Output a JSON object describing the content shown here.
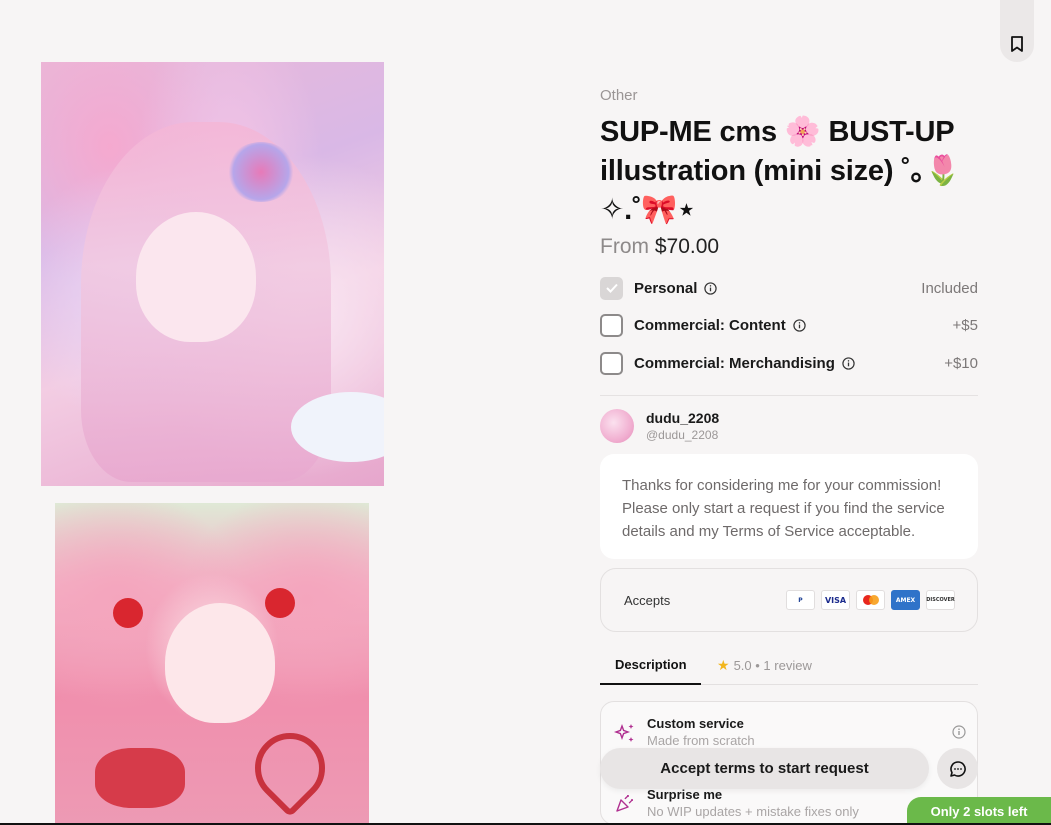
{
  "listing": {
    "category": "Other",
    "title": "SUP-ME cms 🌸 BUST-UP illustration (mini size) ˚｡🌷 ✧.˚🎀⋆",
    "price_prefix": "From",
    "price": "$70.00"
  },
  "licenses": [
    {
      "label": "Personal",
      "price": "Included",
      "checked": true
    },
    {
      "label": "Commercial: Content",
      "price": "+$5",
      "checked": false
    },
    {
      "label": "Commercial: Merchandising",
      "price": "+$10",
      "checked": false
    }
  ],
  "artist": {
    "name": "dudu_2208",
    "handle": "@dudu_2208",
    "message": "Thanks for considering me for your commission! Please only start a request if you find the service details and my Terms of Service acceptable."
  },
  "accepts": {
    "label": "Accepts",
    "methods": [
      "PayPal",
      "VISA",
      "Mastercard",
      "AMEX",
      "DISCOVER"
    ]
  },
  "tabs": {
    "description": "Description",
    "rating": "5.0",
    "reviews": "• 1 review"
  },
  "services": [
    {
      "title": "Custom service",
      "subtitle": "Made from scratch",
      "icon": "sparkles-icon"
    },
    {
      "title": "Surprise me",
      "subtitle": "No WIP updates + mistake fixes only",
      "icon": "party-popper-icon"
    }
  ],
  "cta": {
    "label": "Accept terms to start request"
  },
  "slots_badge": "Only 2 slots left",
  "colors": {
    "accent_green": "#6bb94a",
    "star": "#f2b61c",
    "background": "#f7f5f5"
  }
}
